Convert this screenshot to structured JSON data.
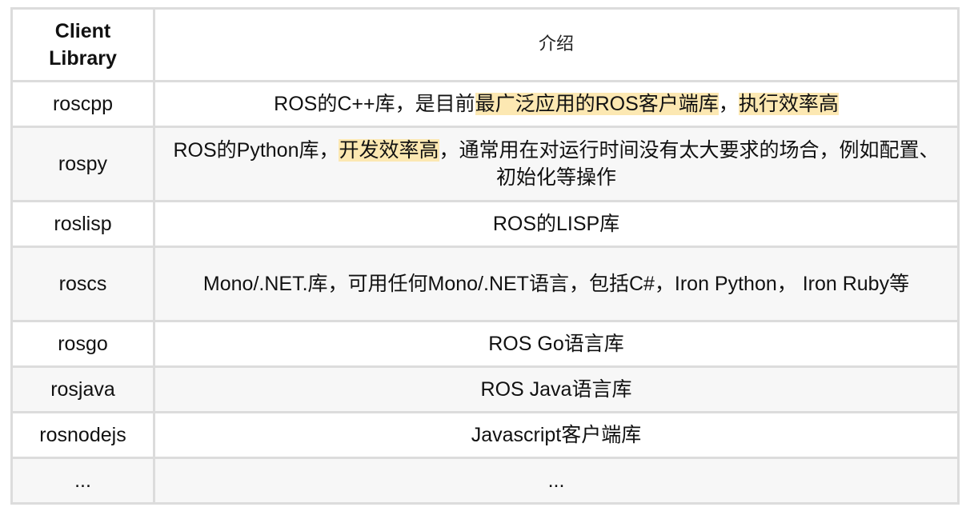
{
  "table": {
    "headers": [
      "Client\nLibrary",
      "介绍"
    ],
    "rows": [
      {
        "name": "roscpp",
        "desc_parts": [
          {
            "text": "ROS的C++库，是目前",
            "hl": false
          },
          {
            "text": "最广泛应用的ROS客户端库",
            "hl": true
          },
          {
            "text": "，",
            "hl": false
          },
          {
            "text": "执行效率高",
            "hl": true
          }
        ]
      },
      {
        "name": "rospy",
        "desc_parts": [
          {
            "text": "ROS的Python库，",
            "hl": false
          },
          {
            "text": "开发效率高",
            "hl": true
          },
          {
            "text": "，通常用在对运行时间没有太大要求的场合，例如配置、初始化等操作",
            "hl": false
          }
        ]
      },
      {
        "name": "roslisp",
        "desc_parts": [
          {
            "text": "ROS的LISP库",
            "hl": false
          }
        ]
      },
      {
        "name": "roscs",
        "desc_parts": [
          {
            "text": "Mono/.NET.库，可用任何Mono/.NET语言，包括C#，Iron Python， Iron Ruby等",
            "hl": false
          }
        ]
      },
      {
        "name": "rosgo",
        "desc_parts": [
          {
            "text": "ROS Go语言库",
            "hl": false
          }
        ]
      },
      {
        "name": "rosjava",
        "desc_parts": [
          {
            "text": "ROS Java语言库",
            "hl": false
          }
        ]
      },
      {
        "name": "rosnodejs",
        "desc_parts": [
          {
            "text": "Javascript客户端库",
            "hl": false
          }
        ]
      },
      {
        "name": "...",
        "desc_parts": [
          {
            "text": "...",
            "hl": false
          }
        ]
      }
    ]
  }
}
